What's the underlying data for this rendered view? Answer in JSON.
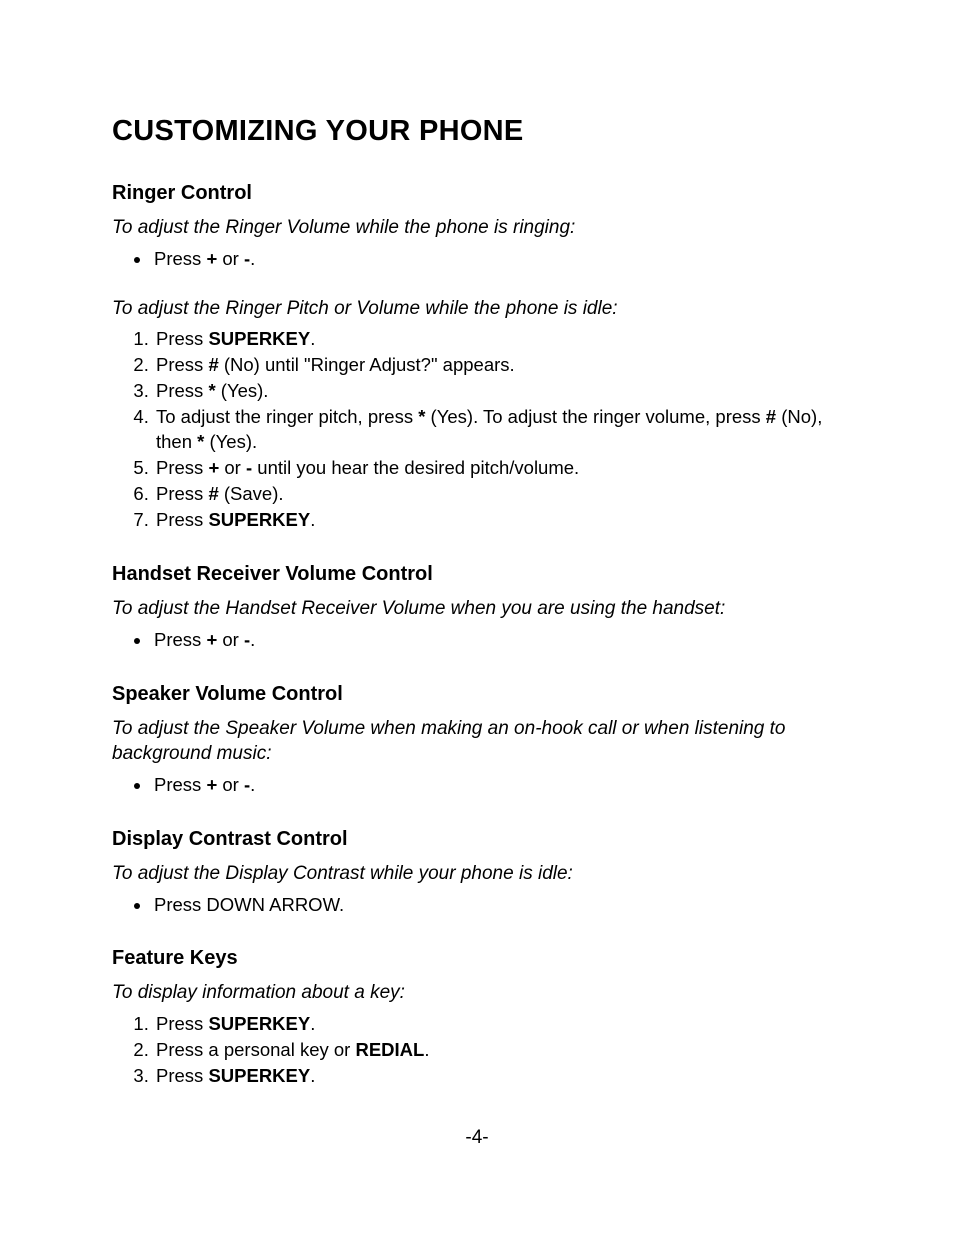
{
  "title": "CUSTOMIZING YOUR PHONE",
  "ringer": {
    "heading": "Ringer Control",
    "intro1": "To adjust the Ringer Volume while the phone is ringing:",
    "b1_a": "Press ",
    "b1_b": "+",
    "b1_c": " or ",
    "b1_d": "-",
    "b1_e": ".",
    "intro2": "To adjust the Ringer Pitch or Volume while the phone is idle:",
    "s1_a": "Press ",
    "s1_b": "SUPERKEY",
    "s1_c": ".",
    "s2_a": "Press ",
    "s2_b": "#",
    "s2_c": " (No) until \"Ringer Adjust?\" appears.",
    "s3_a": "Press ",
    "s3_b": "*",
    "s3_c": " (Yes).",
    "s4_a": "To adjust the ringer pitch, press ",
    "s4_b": "*",
    "s4_c": " (Yes). To adjust the ringer volume, press ",
    "s4_d": "#",
    "s4_e": " (No), then ",
    "s4_f": "*",
    "s4_g": " (Yes).",
    "s5_a": "Press ",
    "s5_b": "+",
    "s5_c": " or ",
    "s5_d": "-",
    "s5_e": " until you hear the desired pitch/volume.",
    "s6_a": "Press ",
    "s6_b": "#",
    "s6_c": " (Save).",
    "s7_a": "Press ",
    "s7_b": "SUPERKEY",
    "s7_c": "."
  },
  "handset": {
    "heading": "Handset Receiver Volume Control",
    "intro": "To adjust the Handset Receiver Volume when you are using the handset:",
    "b1_a": "Press ",
    "b1_b": "+",
    "b1_c": " or ",
    "b1_d": "-",
    "b1_e": "."
  },
  "speaker": {
    "heading": "Speaker Volume Control",
    "intro": "To adjust the Speaker Volume when making an on-hook call or when listening to background music:",
    "b1_a": "Press ",
    "b1_b": "+",
    "b1_c": " or ",
    "b1_d": "-",
    "b1_e": "."
  },
  "display": {
    "heading": "Display Contrast Control",
    "intro": "To adjust the Display Contrast while your phone is idle:",
    "b1": "Press DOWN ARROW."
  },
  "feature": {
    "heading": "Feature Keys",
    "intro": "To display information about a key:",
    "s1_a": "Press ",
    "s1_b": "SUPERKEY",
    "s1_c": ".",
    "s2_a": "Press a personal key or ",
    "s2_b": "REDIAL",
    "s2_c": ".",
    "s3_a": "Press ",
    "s3_b": "SUPERKEY",
    "s3_c": "."
  },
  "page_number": "-4-"
}
